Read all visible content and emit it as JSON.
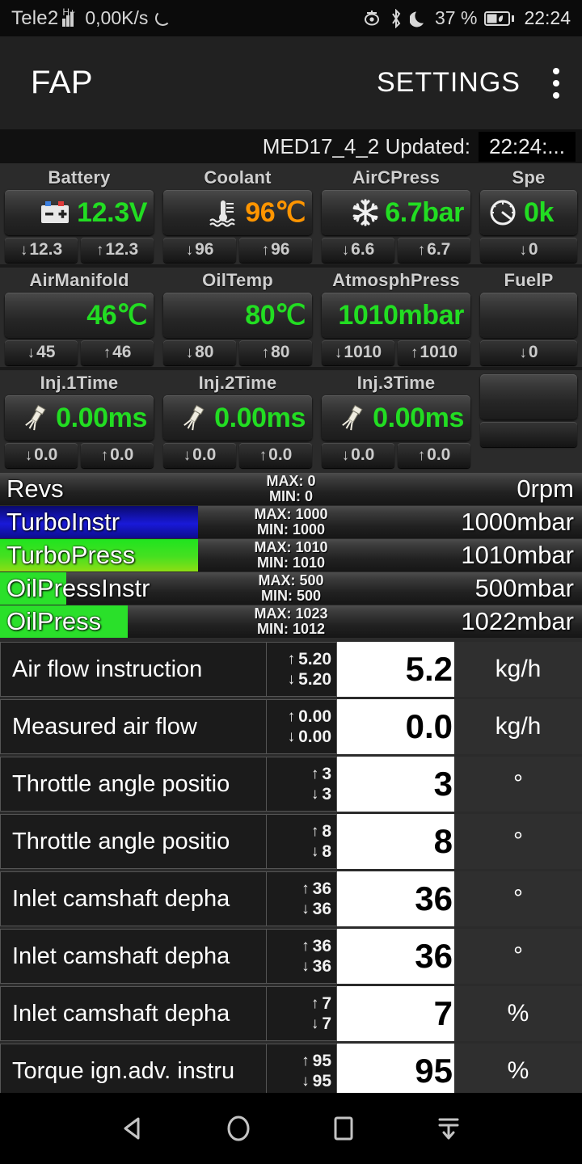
{
  "statusbar": {
    "carrier": "Tele2",
    "network": "H+",
    "data_rate": "0,00K/s",
    "battery_percent": "37 %",
    "clock": "22:24",
    "icons": [
      "signal-bars-icon",
      "sync-spinner-icon",
      "eye-off-icon",
      "bluetooth-icon",
      "do-not-disturb-moon-icon",
      "battery-saver-icon"
    ]
  },
  "appbar": {
    "title": "FAP",
    "settings_label": "SETTINGS",
    "overflow_icon": "kebab-menu-icon"
  },
  "updated": {
    "ecu": "MED17_4_2 Updated:",
    "time": "22:24:..."
  },
  "gauges": [
    {
      "cells": [
        {
          "label": "Battery",
          "icon": "car-battery-icon",
          "value": "12.3V",
          "color": "#22dd22",
          "min": "12.3",
          "max": "12.3"
        },
        {
          "label": "Coolant",
          "icon": "coolant-thermometer-icon",
          "value": "96℃",
          "color": "#ff9500",
          "min": "96",
          "max": "96"
        },
        {
          "label": "AirCPress",
          "icon": "snowflake-icon",
          "value": "6.7bar",
          "color": "#22dd22",
          "min": "6.6",
          "max": "6.7"
        },
        {
          "label": "Spe",
          "icon": "speedometer-icon",
          "value": "0k",
          "color": "#22dd22",
          "min": "0",
          "max": ""
        }
      ]
    },
    {
      "cells": [
        {
          "label": "AirManifold",
          "icon": "",
          "value": "46℃",
          "color": "#22dd22",
          "min": "45",
          "max": "46"
        },
        {
          "label": "OilTemp",
          "icon": "",
          "value": "80℃",
          "color": "#22dd22",
          "min": "80",
          "max": "80"
        },
        {
          "label": "AtmosphPress",
          "icon": "",
          "value": "1010mbar",
          "color": "#22dd22",
          "min": "1010",
          "max": "1010"
        },
        {
          "label": "FuelP",
          "icon": "",
          "value": "",
          "color": "#22dd22",
          "min": "0",
          "max": ""
        }
      ]
    },
    {
      "cells": [
        {
          "label": "Inj.1Time",
          "icon": "fuel-injector-icon",
          "value": "0.00ms",
          "color": "#22dd22",
          "min": "0.0",
          "max": "0.0"
        },
        {
          "label": "Inj.2Time",
          "icon": "fuel-injector-icon",
          "value": "0.00ms",
          "color": "#22dd22",
          "min": "0.0",
          "max": "0.0"
        },
        {
          "label": "Inj.3Time",
          "icon": "fuel-injector-icon",
          "value": "0.00ms",
          "color": "#22dd22",
          "min": "0.0",
          "max": "0.0"
        },
        {
          "label": "",
          "icon": "",
          "value": "",
          "color": "#22dd22",
          "min": "",
          "max": ""
        }
      ]
    }
  ],
  "bars": [
    {
      "name": "Revs",
      "max": "MAX: 0",
      "min": "MIN: 0",
      "value": "0rpm",
      "fill_pct": 0,
      "fill_color": "none"
    },
    {
      "name": "TurboInstr",
      "max": "MAX: 1000",
      "min": "MIN: 1000",
      "value": "1000mbar",
      "fill_pct": 34,
      "fill_color": "#1919d8"
    },
    {
      "name": "TurboPress",
      "max": "MAX: 1010",
      "min": "MIN: 1010",
      "value": "1010mbar",
      "fill_pct": 34,
      "fill_color": "#47e020"
    },
    {
      "name": "OilPressInstr",
      "max": "MAX: 500",
      "min": "MIN: 500",
      "value": "500mbar",
      "fill_pct": 11.4,
      "fill_color": "#2ae02a"
    },
    {
      "name": "OilPress",
      "max": "MAX: 1023",
      "min": "MIN: 1012",
      "value": "1022mbar",
      "fill_pct": 22,
      "fill_color": "#2ae02a"
    }
  ],
  "table": [
    {
      "name": "Air flow instruction",
      "max": "5.20",
      "min": "5.20",
      "value": "5.2",
      "unit": "kg/h"
    },
    {
      "name": "Measured air flow",
      "max": "0.00",
      "min": "0.00",
      "value": "0.0",
      "unit": "kg/h"
    },
    {
      "name": "Throttle angle positio",
      "max": "3",
      "min": "3",
      "value": "3",
      "unit": "°"
    },
    {
      "name": "Throttle angle positio",
      "max": "8",
      "min": "8",
      "value": "8",
      "unit": "°"
    },
    {
      "name": "Inlet camshaft depha",
      "max": "36",
      "min": "36",
      "value": "36",
      "unit": "°"
    },
    {
      "name": "Inlet camshaft depha",
      "max": "36",
      "min": "36",
      "value": "36",
      "unit": "°"
    },
    {
      "name": "Inlet camshaft depha",
      "max": "7",
      "min": "7",
      "value": "7",
      "unit": "%"
    },
    {
      "name": "Torque ign.adv. instru",
      "max": "95",
      "min": "95",
      "value": "95",
      "unit": "%"
    }
  ],
  "navbar": {
    "back_icon": "back-triangle-icon",
    "home_icon": "home-circle-icon",
    "recents_icon": "recents-square-icon",
    "hide_icon": "hide-navbar-icon"
  }
}
